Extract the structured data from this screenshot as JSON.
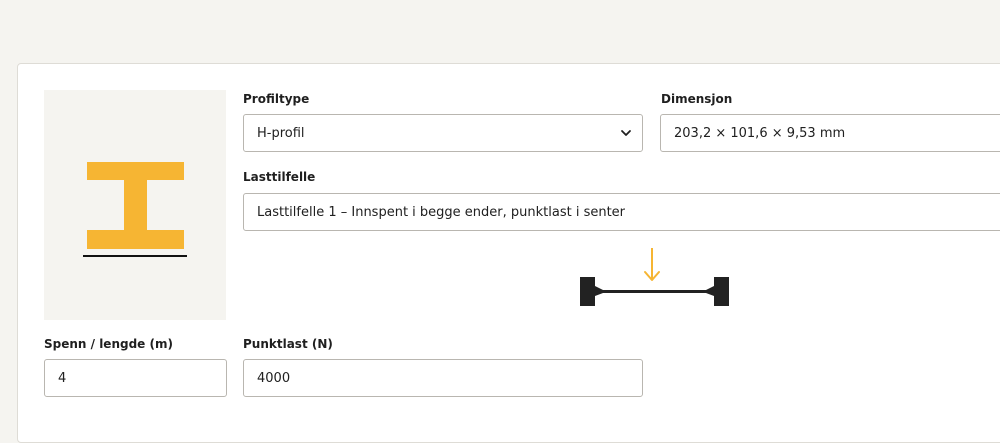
{
  "form": {
    "profile_type": {
      "label": "Profiltype",
      "value": "H-profil"
    },
    "dimension": {
      "label": "Dimensjon",
      "value": "203,2 × 101,6 × 9,53 mm"
    },
    "load_case": {
      "label": "Lasttilfelle",
      "value": "Lasttilfelle 1 – Innspent i begge ender, punktlast i senter"
    },
    "span": {
      "label": "Spenn / lengde (m)",
      "value": "4"
    },
    "point_load": {
      "label": "Punktlast (N)",
      "value": "4000"
    }
  },
  "visuals": {
    "accent_color": "#f6b533",
    "icon": "h-beam-profile-icon",
    "load_diagram_icon": "fixed-ends-point-load-diagram"
  }
}
